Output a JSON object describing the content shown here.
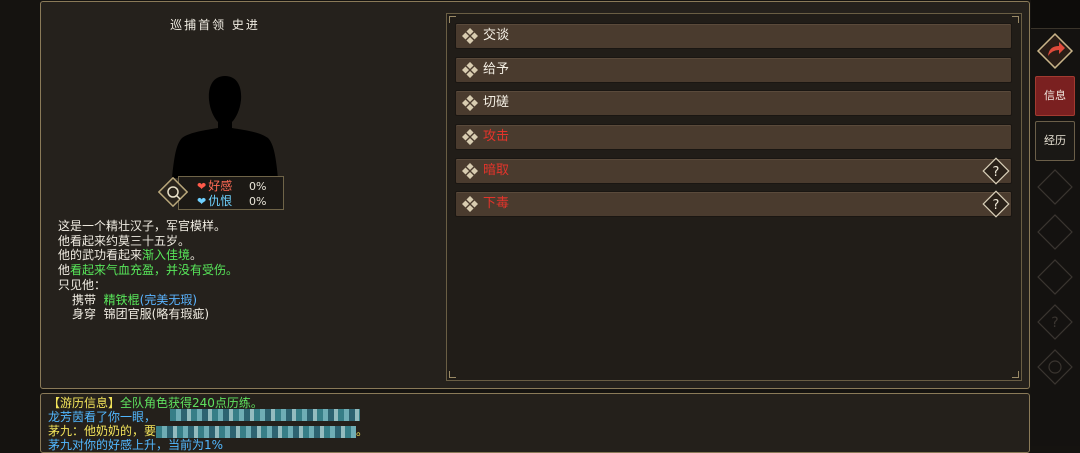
{
  "npc": {
    "title": "巡捕首领  史进",
    "favor_label": "好感",
    "favor_value": "0%",
    "hatred_label": "仇恨",
    "hatred_value": "0%"
  },
  "description": {
    "line1": "这是一个精壮汉子，军官模样。",
    "line2": "他看起来约莫三十五岁。",
    "line3_prefix": "他的武功看起来",
    "line3_green": "渐入佳境",
    "line3_suffix": "。",
    "line4_prefix": "他",
    "line4_green": "看起来气血充盈，并没有受伤。",
    "line5": "只见他：",
    "carry_label": "携带",
    "carry_item": "精铁棍",
    "carry_quality": "(完美无瑕)",
    "wear_label": "身穿",
    "wear_item": "锦团官服(略有瑕疵)"
  },
  "actions": [
    {
      "label": "交谈",
      "danger": false,
      "help": false
    },
    {
      "label": "给予",
      "danger": false,
      "help": false
    },
    {
      "label": "切磋",
      "danger": false,
      "help": false
    },
    {
      "label": "攻击",
      "danger": true,
      "help": false
    },
    {
      "label": "暗取",
      "danger": true,
      "help": true
    },
    {
      "label": "下毒",
      "danger": true,
      "help": true
    }
  ],
  "side": {
    "info_label": "信息",
    "history_label": "经历",
    "help_glyph": "?"
  },
  "log": {
    "line1_tag": "【游历信息】",
    "line1_text": "全队角色获得240点历练。",
    "line2": "龙芳茵看了你一眼，",
    "line3_prefix": "茅九：他奶奶的，要",
    "line3_suffix": "。",
    "line4": "茅九对你的好感上升，当前为1%"
  },
  "colors": {
    "accent_gold": "#8a7a58",
    "button_brown": "#4a3b2e",
    "danger_red": "#e3342b",
    "info_red": "#7a2020",
    "text_green": "#58e85a",
    "text_blue": "#5ab4ff"
  },
  "icons": [
    "diamond-bullet-icon",
    "help-question-icon",
    "return-arrow-icon",
    "favor-heart-icon",
    "hatred-heart-icon",
    "relation-emblem-icon"
  ]
}
